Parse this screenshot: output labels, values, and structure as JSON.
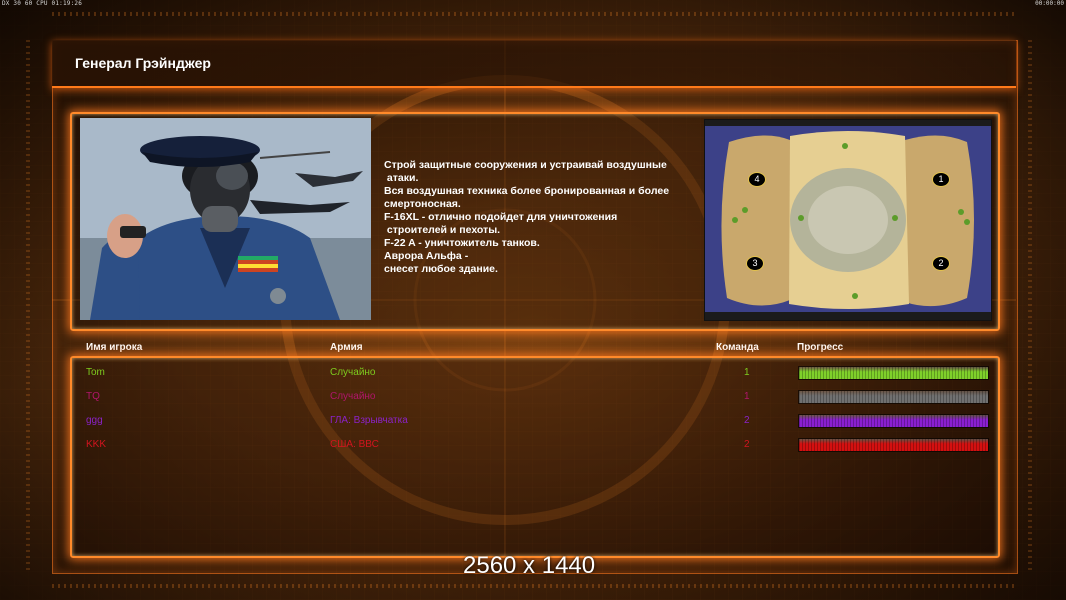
{
  "osd": {
    "left": "DX 30 60 CPU 01:19:26",
    "right": "00:00:00"
  },
  "general": {
    "name": "Генерал Грэйнджер"
  },
  "briefing": {
    "lines": [
      "Строй защитные сооружения и устраивай воздушные",
      " атаки.",
      "Вся воздушная техника более бронированная и более",
      "смертоносная.",
      "F-16XL - отлично подойдет для уничтожения",
      " строителей и пехоты.",
      "F-22 A - уничтожитель танков.",
      "Аврора Альфа -",
      "снесет любое здание."
    ]
  },
  "minimap": {
    "start_positions": [
      "4",
      "1",
      "3",
      "2"
    ]
  },
  "table": {
    "headers": {
      "player": "Имя игрока",
      "army": "Армия",
      "team": "Команда",
      "progress": "Прогресс"
    },
    "rows": [
      {
        "player": "Tom",
        "army": "Случайно",
        "team": "1",
        "color": "#7ecb1e",
        "bar_color": "#7fd02a",
        "progress": 1.0
      },
      {
        "player": "TQ",
        "army": "Случайно",
        "team": "1",
        "color": "#b0166a",
        "bar_color": "#707070",
        "progress": 1.0
      },
      {
        "player": "ggg",
        "army": "ГЛА: Взрывчатка",
        "team": "2",
        "color": "#8a22c6",
        "bar_color": "#8a1fd0",
        "progress": 1.0
      },
      {
        "player": "KKK",
        "army": "США: ВВС",
        "team": "2",
        "color": "#d2141e",
        "bar_color": "#d41010",
        "progress": 1.0
      }
    ]
  },
  "resolution_label": "2560 x 1440",
  "colors": {
    "accent": "#ff8a2a",
    "text": "#ffffff"
  }
}
